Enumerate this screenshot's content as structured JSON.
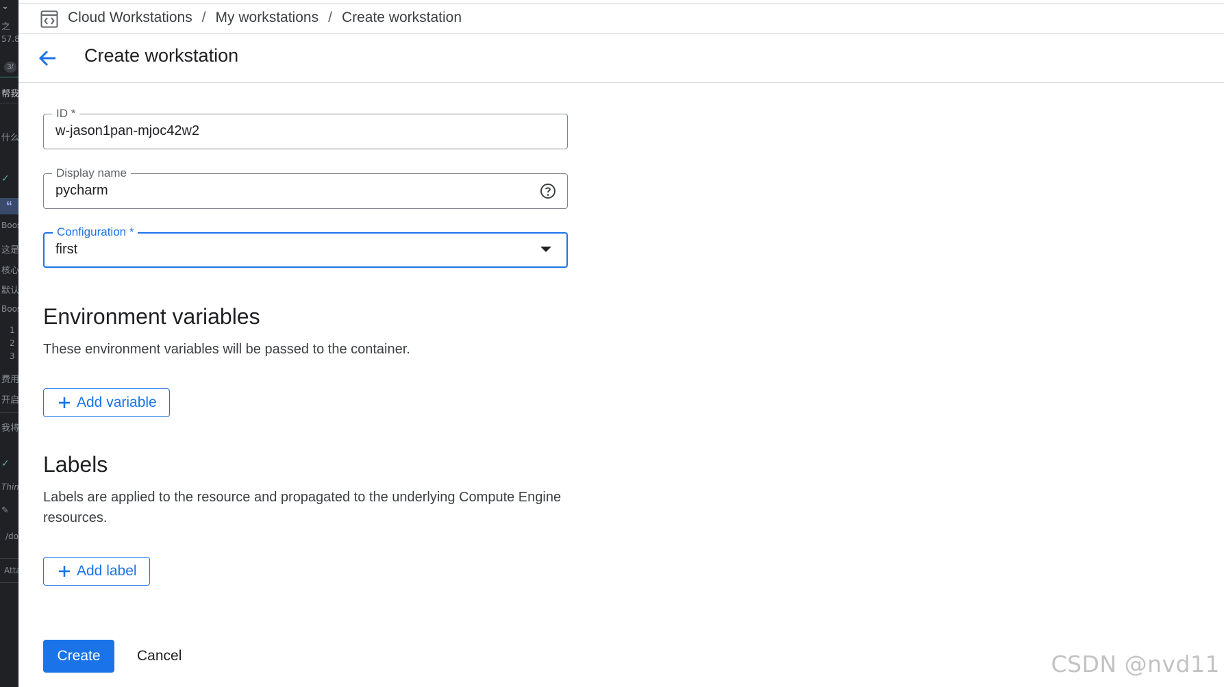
{
  "left_strip": {
    "items": [
      {
        "text": "之"
      },
      {
        "text": "57.8"
      },
      {
        "text": "3/"
      },
      {
        "text": "帮我"
      },
      {
        "text": "什么"
      },
      {
        "text": "Boos"
      },
      {
        "text": "这是"
      },
      {
        "text": "核心"
      },
      {
        "text": "默认"
      },
      {
        "text": "Boos"
      },
      {
        "text": "1"
      },
      {
        "text": "2"
      },
      {
        "text": "3"
      },
      {
        "text": "费用"
      },
      {
        "text": "开启"
      },
      {
        "text": "我将"
      },
      {
        "text": "Thin"
      },
      {
        "text": "/do"
      },
      {
        "text": "Atta"
      }
    ],
    "quote_glyph": "“"
  },
  "breadcrumb": {
    "items": [
      "Cloud Workstations",
      "My workstations",
      "Create workstation"
    ],
    "separator": "/"
  },
  "header": {
    "title": "Create workstation"
  },
  "form": {
    "id_field": {
      "label": "ID *",
      "value": "w-jason1pan-mjoc42w2"
    },
    "display_name_field": {
      "label": "Display name",
      "value": "pycharm"
    },
    "configuration_field": {
      "label": "Configuration *",
      "value": "first"
    }
  },
  "env_section": {
    "title": "Environment variables",
    "description": "These environment variables will be passed to the container.",
    "button_label": "Add variable"
  },
  "labels_section": {
    "title": "Labels",
    "description": "Labels are applied to the resource and propagated to the underlying Compute Engine resources.",
    "button_label": "Add label"
  },
  "actions": {
    "create_label": "Create",
    "cancel_label": "Cancel"
  },
  "watermark": "CSDN @nvd11",
  "colors": {
    "accent": "#1a73e8",
    "text": "#202124",
    "border": "#80868b"
  }
}
